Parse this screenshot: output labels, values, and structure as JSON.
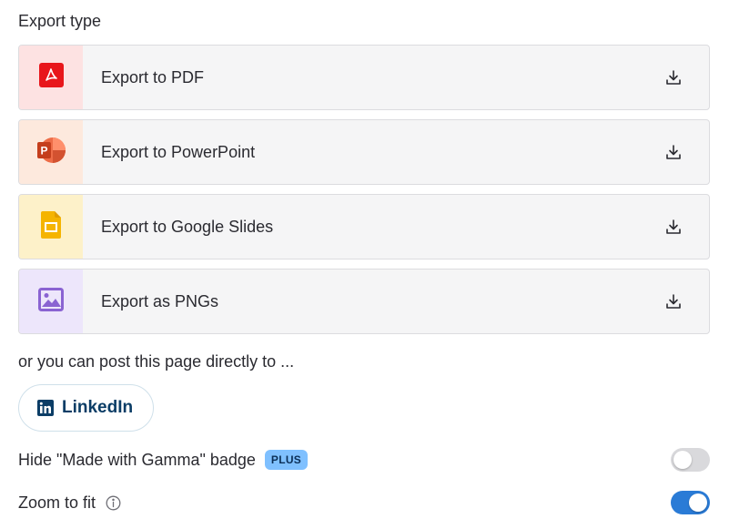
{
  "section_label": "Export type",
  "exports": [
    {
      "label": "Export to PDF",
      "icon": "pdf-icon"
    },
    {
      "label": "Export to PowerPoint",
      "icon": "powerpoint-icon"
    },
    {
      "label": "Export to Google Slides",
      "icon": "google-slides-icon"
    },
    {
      "label": "Export as PNGs",
      "icon": "image-icon"
    }
  ],
  "post_label": "or you can post this page directly to ...",
  "linkedin": {
    "label": "LinkedIn",
    "icon": "linkedin-icon"
  },
  "settings": {
    "hide_badge": {
      "label": "Hide \"Made with Gamma\" badge",
      "badge": "PLUS",
      "enabled": false
    },
    "zoom_to_fit": {
      "label": "Zoom to fit",
      "enabled": true
    }
  },
  "colors": {
    "accent": "#2a7bd6",
    "pdf": "#e8161b",
    "powerpoint": "#d0442a",
    "google_slides": "#f5b400",
    "png": "#8a63d2",
    "linkedin": "#0b3d66",
    "plus_badge": "#7fc0ff"
  }
}
